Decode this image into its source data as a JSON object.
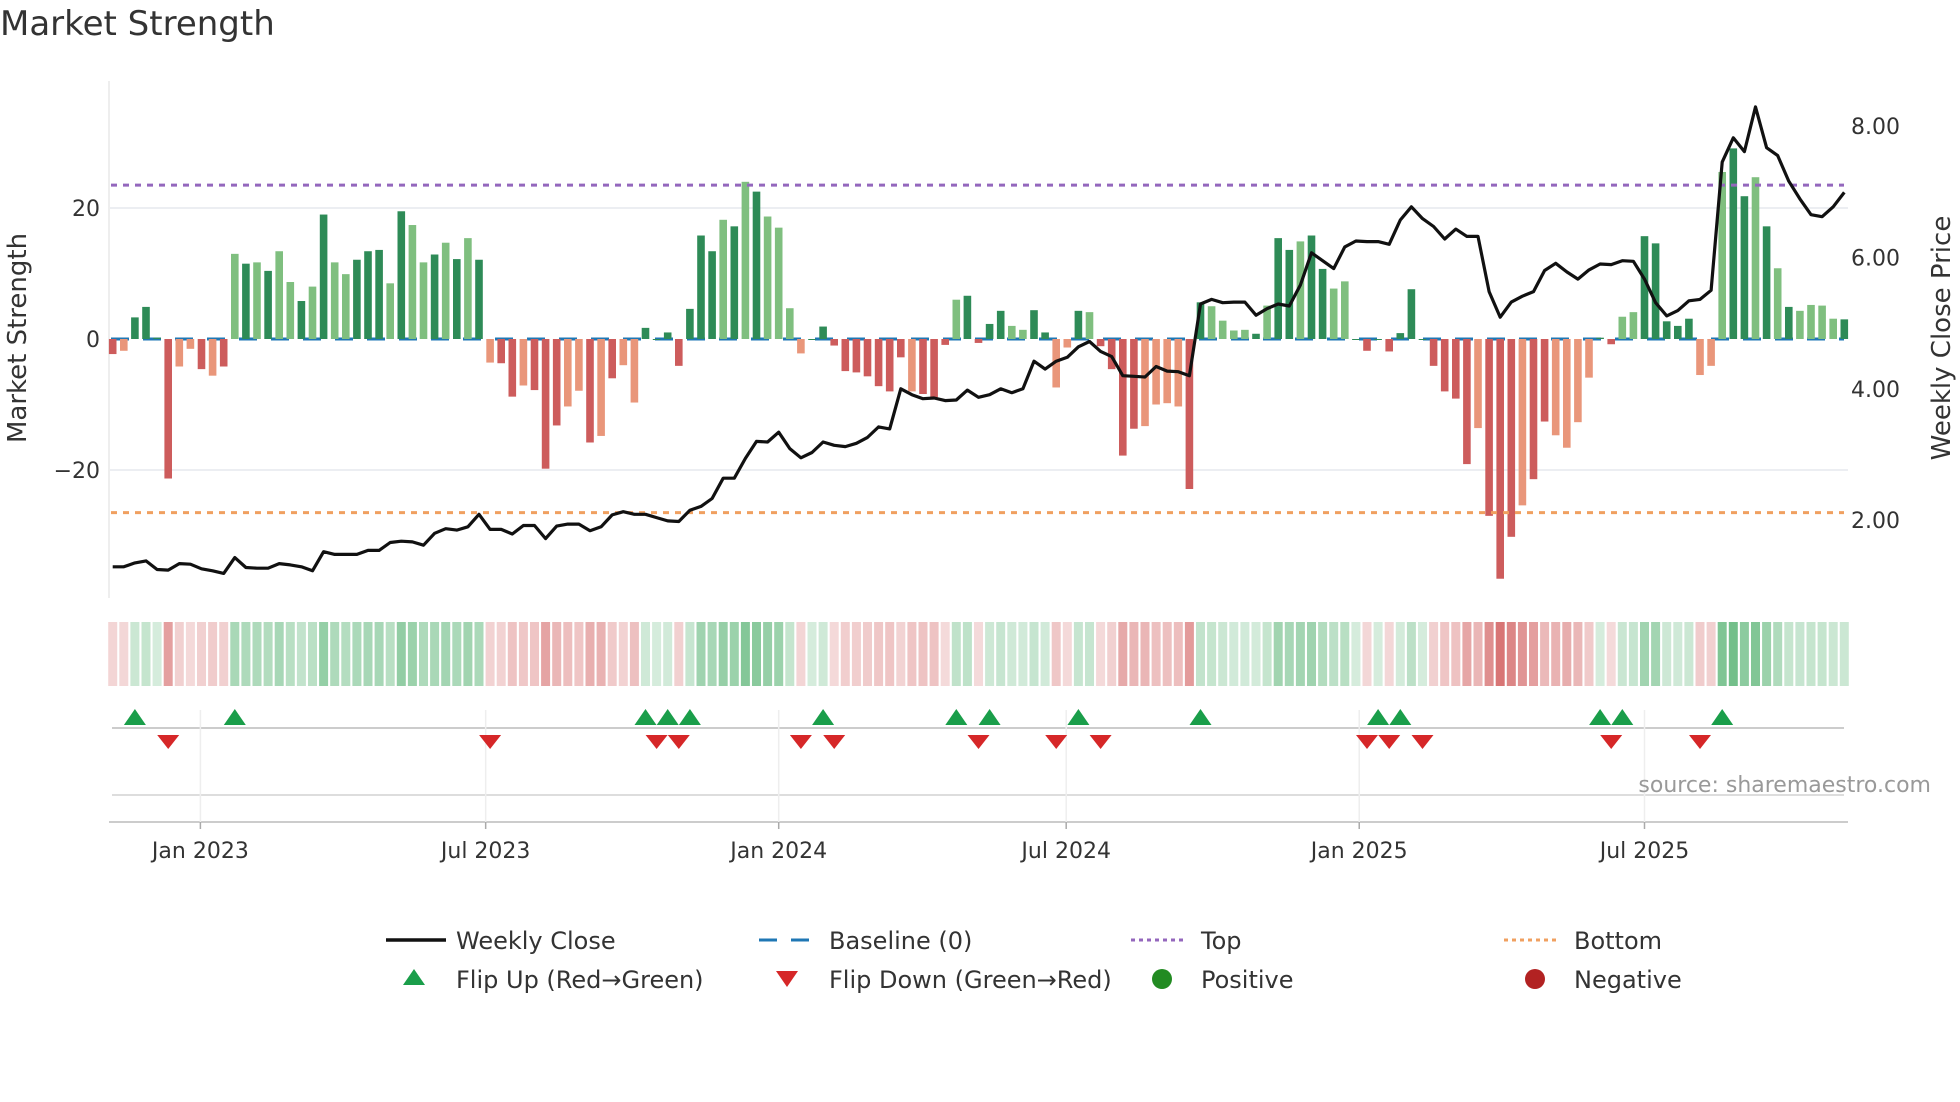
{
  "title": "Market Strength",
  "chart_data": {
    "type": "bar",
    "title": "Market Strength",
    "ylabel": "Market Strength",
    "y2label": "Weekly Close Price",
    "ylim": [
      -38,
      35
    ],
    "y2lim": [
      1.0,
      8.7
    ],
    "yticks": [
      {
        "v": 20,
        "label": "20"
      },
      {
        "v": 0,
        "label": "0"
      },
      {
        "v": -20,
        "label": "−20"
      }
    ],
    "y2ticks": [
      {
        "v": 8,
        "label": "8.00"
      },
      {
        "v": 6,
        "label": "6.00"
      },
      {
        "v": 4,
        "label": "4.00"
      },
      {
        "v": 2,
        "label": "2.00"
      }
    ],
    "xticks": [
      {
        "week": 7.9,
        "label": "Jan 2023"
      },
      {
        "week": 33.6,
        "label": "Jul 2023"
      },
      {
        "week": 60,
        "label": "Jan 2024"
      },
      {
        "week": 85.9,
        "label": "Jul 2024"
      },
      {
        "week": 112.3,
        "label": "Jan 2025"
      },
      {
        "week": 138,
        "label": "Jul 2025"
      }
    ],
    "top_level": 23.5,
    "bottom_level": -26.5,
    "baseline": 0,
    "strength": [
      -2.3,
      -1.8,
      3.3,
      4.9,
      0.2,
      -21.3,
      -4.2,
      -1.5,
      -4.6,
      -5.6,
      -4.2,
      13,
      11.5,
      11.7,
      10.4,
      13.4,
      8.7,
      5.8,
      8.0,
      19,
      11.7,
      9.9,
      12.1,
      13.4,
      13.6,
      8.5,
      19.5,
      17.4,
      11.7,
      12.9,
      14.7,
      12.2,
      15.4,
      12.1,
      -3.6,
      -3.7,
      -8.8,
      -7.1,
      -7.8,
      -19.8,
      -13.2,
      -10.3,
      -7.9,
      -15.8,
      -14.8,
      -6.0,
      -4.0,
      -9.7,
      1.7,
      0,
      1.0,
      -4.1,
      4.6,
      15.8,
      13.4,
      18.2,
      17.2,
      24,
      22.5,
      18.7,
      17,
      4.7,
      -2.2,
      0,
      1.9,
      -1.0,
      -4.9,
      -5.1,
      -5.7,
      -7.2,
      -8.0,
      -2.8,
      -8.0,
      -8.4,
      -8.9,
      -0.9,
      6.0,
      6.6,
      -0.6,
      2.3,
      4.3,
      2.0,
      1.4,
      4.4,
      1.0,
      -7.4,
      -1.3,
      4.3,
      4.1,
      -1.1,
      -4.6,
      -17.8,
      -13.7,
      -13.3,
      -10.0,
      -9.8,
      -10.3,
      -22.9,
      5.6,
      5.0,
      2.8,
      1.3,
      1.4,
      0.8,
      5.1,
      15.4,
      13.6,
      14.9,
      15.8,
      10.7,
      7.7,
      8.8,
      0,
      -1.8,
      0,
      -1.9,
      0.9,
      7.6,
      0,
      -4.1,
      -8.0,
      -9.1,
      -19.1,
      -13.6,
      -27,
      -36.6,
      -30.2,
      -25.4,
      -21.4,
      -12.6,
      -14.7,
      -16.6,
      -12.7,
      -5.9,
      0.2,
      -0.8,
      3.4,
      4.1,
      15.7,
      14.6,
      2.7,
      2.0,
      3.1,
      -5.5,
      -4.1,
      25.5,
      29.1,
      21.8,
      24.7,
      17.2,
      10.8,
      4.9,
      4.3,
      5.2,
      5.1,
      3.1,
      3.0
    ],
    "shade": "dlddddlldldldldlldldlldddldlldldldlddldddlldldlldddddddldldlllldddddddddldddlddddllddlldlddddllllddlllldlddlddlldddddddddddldddlddllllddlldddddlllddldldlllldlll",
    "weekly_close": [
      1.29,
      1.29,
      1.35,
      1.38,
      1.25,
      1.24,
      1.34,
      1.33,
      1.26,
      1.23,
      1.19,
      1.43,
      1.28,
      1.27,
      1.27,
      1.34,
      1.32,
      1.29,
      1.23,
      1.52,
      1.48,
      1.48,
      1.48,
      1.54,
      1.54,
      1.66,
      1.68,
      1.67,
      1.62,
      1.8,
      1.87,
      1.85,
      1.9,
      2.09,
      1.86,
      1.86,
      1.79,
      1.92,
      1.92,
      1.72,
      1.91,
      1.94,
      1.94,
      1.84,
      1.9,
      2.08,
      2.13,
      2.09,
      2.09,
      2.04,
      1.99,
      1.98,
      2.15,
      2.21,
      2.33,
      2.64,
      2.64,
      2.94,
      3.2,
      3.19,
      3.34,
      3.09,
      2.95,
      3.03,
      3.19,
      3.14,
      3.12,
      3.17,
      3.26,
      3.42,
      3.39,
      4.0,
      3.91,
      3.85,
      3.86,
      3.82,
      3.83,
      3.98,
      3.87,
      3.91,
      4.0,
      3.94,
      4.0,
      4.42,
      4.3,
      4.42,
      4.48,
      4.64,
      4.72,
      4.57,
      4.49,
      4.2,
      4.19,
      4.18,
      4.34,
      4.27,
      4.26,
      4.2,
      5.29,
      5.36,
      5.31,
      5.32,
      5.32,
      5.12,
      5.22,
      5.29,
      5.26,
      5.58,
      6.07,
      5.95,
      5.83,
      6.16,
      6.25,
      6.24,
      6.24,
      6.2,
      6.57,
      6.77,
      6.59,
      6.47,
      6.28,
      6.43,
      6.32,
      6.32,
      5.48,
      5.09,
      5.32,
      5.41,
      5.48,
      5.8,
      5.91,
      5.78,
      5.67,
      5.81,
      5.9,
      5.89,
      5.95,
      5.94,
      5.67,
      5.31,
      5.11,
      5.19,
      5.34,
      5.36,
      5.5,
      7.45,
      7.82,
      7.61,
      8.29,
      7.67,
      7.55,
      7.16,
      6.89,
      6.65,
      6.62,
      6.77,
      6.99
    ],
    "flip_up_weeks": [
      2,
      11,
      48,
      50,
      52,
      64,
      76,
      79,
      87,
      98,
      114,
      116,
      134,
      136,
      145
    ],
    "flip_down_weeks": [
      5,
      34,
      49,
      51,
      62,
      65,
      78,
      85,
      89,
      113,
      115,
      118,
      135,
      143
    ],
    "legend": [
      {
        "key": "close",
        "label": "Weekly Close"
      },
      {
        "key": "baseline",
        "label": "Baseline (0)"
      },
      {
        "key": "top",
        "label": "Top"
      },
      {
        "key": "bottom",
        "label": "Bottom"
      },
      {
        "key": "flipup",
        "label": "Flip Up (Red→Green)"
      },
      {
        "key": "flipdown",
        "label": "Flip Down (Green→Red)"
      },
      {
        "key": "positive",
        "label": "Positive"
      },
      {
        "key": "negative",
        "label": "Negative"
      }
    ],
    "legend_placement": "bottom",
    "source": "source: sharemaestro.com"
  },
  "colors": {
    "pos_strong": "#2e8b57",
    "pos_weak": "#7fbf7f",
    "neg_strong": "#cd5c5c",
    "neg_weak": "#e9967a",
    "close": "#111111",
    "baseline": "#1f77b4",
    "top": "#9467bd",
    "bottom": "#f0a060",
    "flip_up": "#1a9e4a",
    "flip_down": "#d62728",
    "positive": "#228b22",
    "negative": "#b22222"
  }
}
